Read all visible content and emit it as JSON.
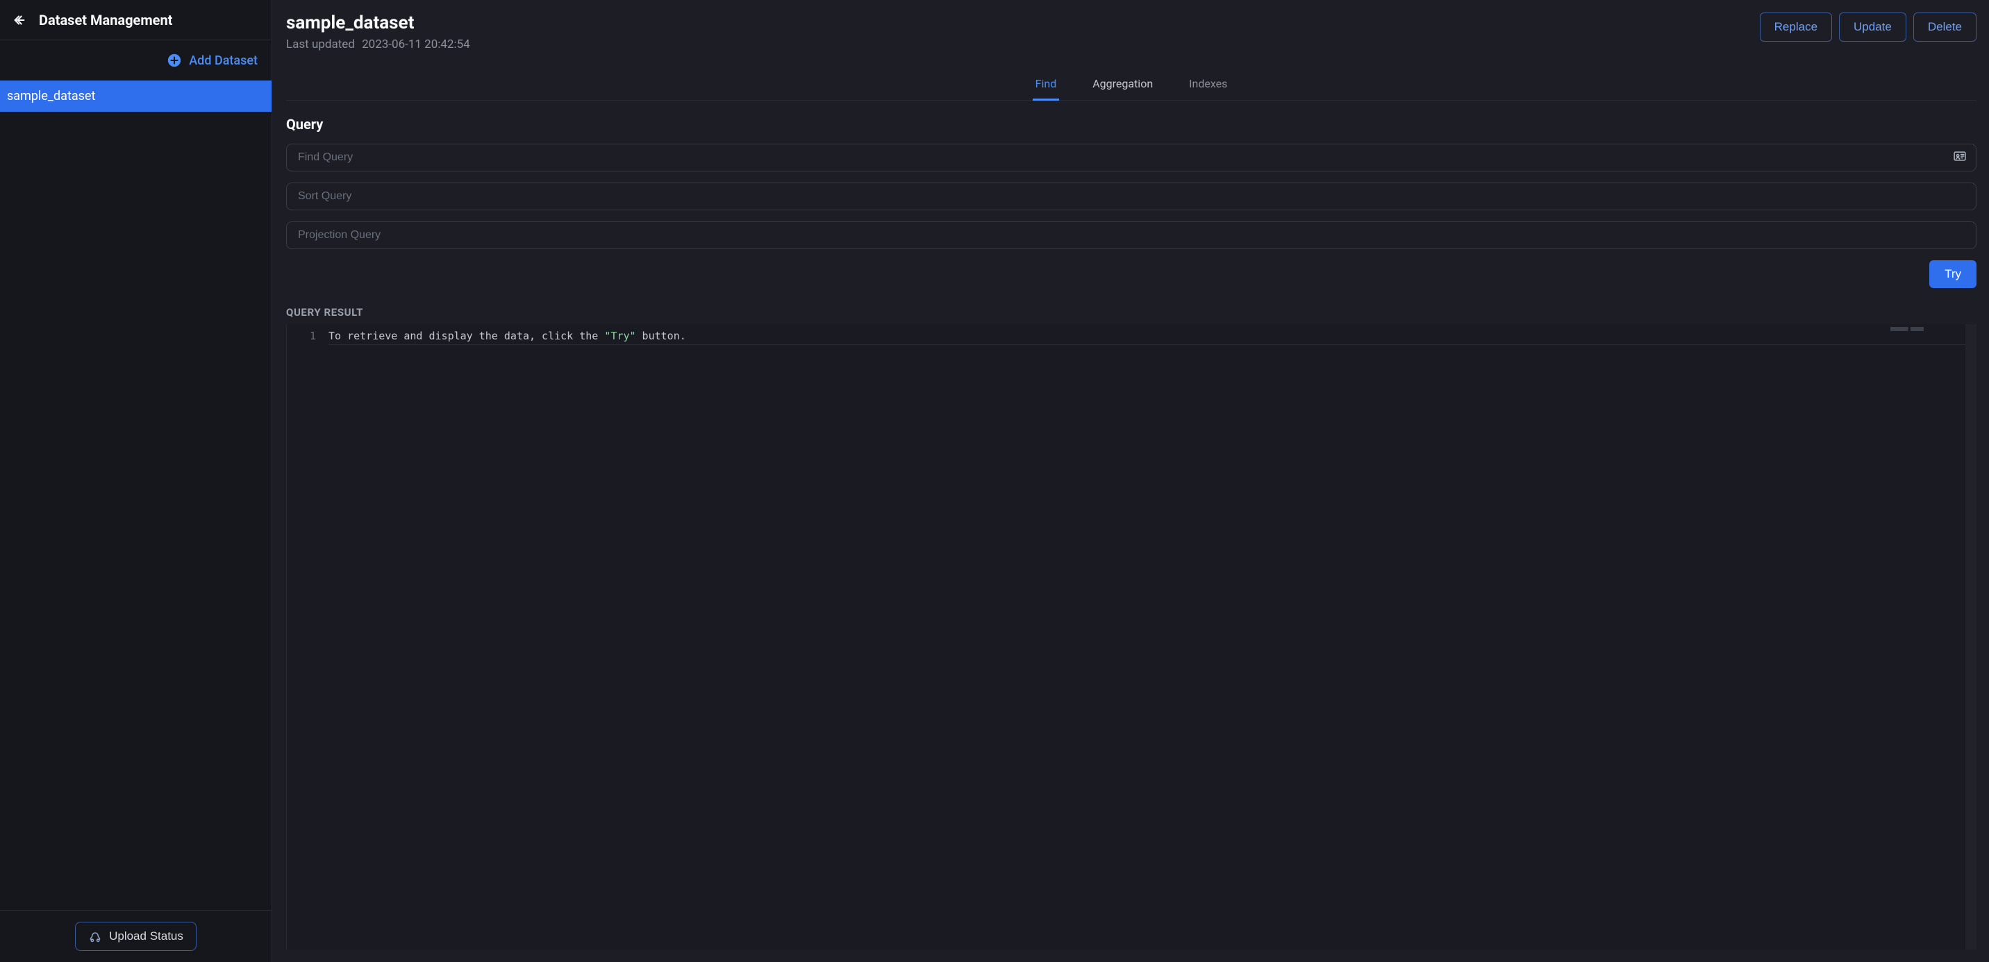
{
  "sidebar": {
    "title": "Dataset Management",
    "add_label": "Add Dataset",
    "items": [
      {
        "label": "sample_dataset",
        "active": true
      }
    ],
    "upload_status_label": "Upload Status"
  },
  "header": {
    "dataset_name": "sample_dataset",
    "last_updated_label": "Last updated",
    "last_updated_value": "2023-06-11 20:42:54",
    "actions": {
      "replace": "Replace",
      "update": "Update",
      "delete": "Delete"
    }
  },
  "tabs": [
    {
      "id": "find",
      "label": "Find",
      "state": "active"
    },
    {
      "id": "aggregation",
      "label": "Aggregation",
      "state": "normal"
    },
    {
      "id": "indexes",
      "label": "Indexes",
      "state": "dim"
    }
  ],
  "query": {
    "heading": "Query",
    "find_placeholder": "Find Query",
    "sort_placeholder": "Sort Query",
    "projection_placeholder": "Projection Query",
    "try_label": "Try"
  },
  "result": {
    "label": "QUERY RESULT",
    "line_number": "1",
    "msg_pre": "To retrieve and display the data, click the ",
    "msg_str": "\"Try\"",
    "msg_post": " button."
  }
}
